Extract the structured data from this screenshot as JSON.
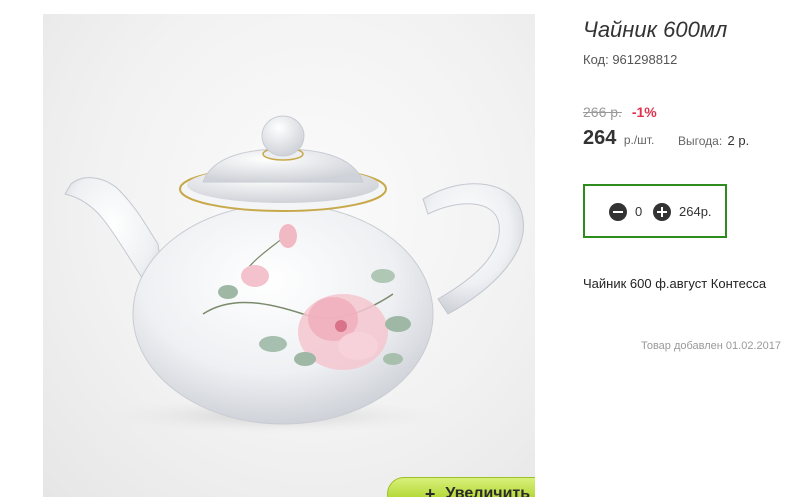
{
  "product": {
    "title": "Чайник 600мл",
    "code": "Код: 961298812",
    "old_price": "266 р.",
    "discount": "-1%",
    "price": "264",
    "unit": "р./шт.",
    "benefit_label": "Выгода:",
    "benefit_value": "2 р.",
    "description": "Чайник 600 ф.август Контесса",
    "added": "Товар добавлен 01.02.2017"
  },
  "quantity": {
    "value": "0",
    "total": "264р."
  },
  "gallery": {
    "zoom_label": "Увеличить",
    "zoom_icon": "plus-icon",
    "image_alt": "teapot-photo"
  },
  "colors": {
    "accent_green": "#2e8b1e",
    "discount_red": "#e0334f",
    "zoom_button": "#b5d93a"
  }
}
